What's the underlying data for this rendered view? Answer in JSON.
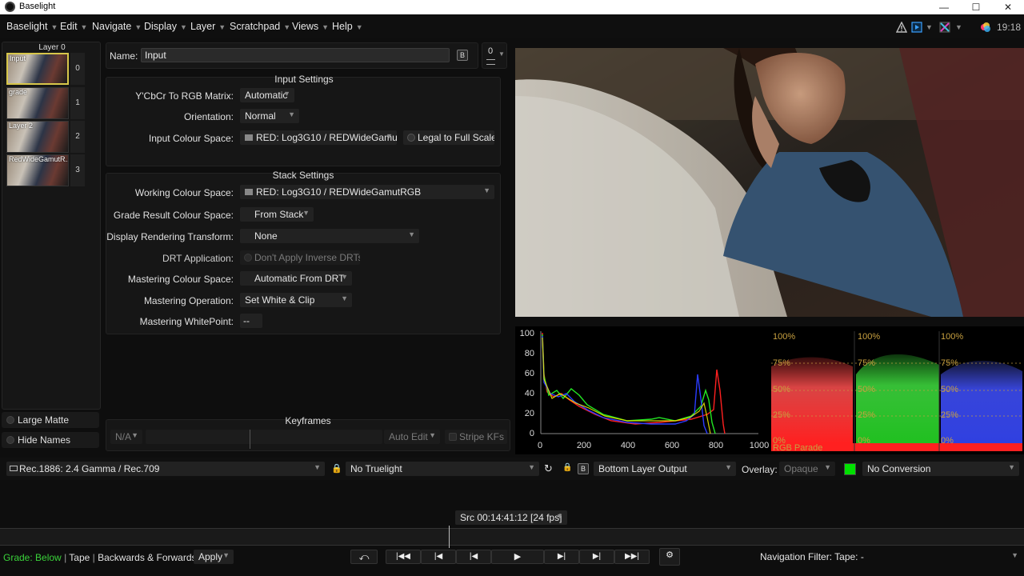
{
  "window": {
    "title": "Baselight",
    "minimize": "—",
    "maximize": "☐",
    "close": "✕"
  },
  "menubar": {
    "items": [
      "Baselight",
      "Edit",
      "Navigate",
      "Display",
      "Layer",
      "Scratchpad",
      "Views",
      "Help"
    ],
    "clock": "19:18"
  },
  "layers": {
    "header": "Layer 0",
    "list": [
      {
        "name": "Input",
        "num": "0"
      },
      {
        "name": "grade",
        "num": "1"
      },
      {
        "name": "Layer 2",
        "num": "2"
      },
      {
        "name": "RedWideGamutR...",
        "num": "3"
      }
    ],
    "large_matte": "Large Matte",
    "hide_names": "Hide Names"
  },
  "name_bar": {
    "label": "Name:",
    "value": "Input",
    "badge": "B",
    "counter": "0"
  },
  "input_settings": {
    "title": "Input Settings",
    "ycbcr_label": "Y'CbCr To RGB Matrix:",
    "ycbcr_value": "Automatic",
    "orientation_label": "Orientation:",
    "orientation_value": "Normal",
    "colour_space_label": "Input Colour Space:",
    "colour_space_value": "RED: Log3G10 / REDWideGamu",
    "legal_button": "Legal to Full Scale"
  },
  "stack_settings": {
    "title": "Stack Settings",
    "working_label": "Working Colour Space:",
    "working_value": "RED: Log3G10 / REDWideGamutRGB",
    "grade_result_label": "Grade Result Colour Space:",
    "grade_result_value": "From Stack",
    "drt_label": "Display Rendering Transform:",
    "drt_value": "None",
    "drt_app_label": "DRT Application:",
    "drt_app_value": "Don't Apply Inverse DRTs",
    "mastering_cs_label": "Mastering Colour Space:",
    "mastering_cs_value": "Automatic From DRT",
    "mastering_op_label": "Mastering Operation:",
    "mastering_op_value": "Set White & Clip",
    "whitepoint_label": "Mastering WhitePoint:",
    "whitepoint_value": "--"
  },
  "keyframes": {
    "title": "Keyframes",
    "na": "N/A",
    "auto_edit": "Auto Edit",
    "stripe": "Stripe KFs"
  },
  "histogram": {
    "y_ticks": [
      "100",
      "80",
      "60",
      "40",
      "20",
      "0"
    ],
    "x_ticks": [
      "0",
      "200",
      "400",
      "600",
      "800",
      "1000"
    ],
    "colors": {
      "red": "#ff2020",
      "green": "#22e622",
      "blue": "#2a3cff",
      "yellow": "#e8e800"
    }
  },
  "parade": {
    "pct_top": "100%",
    "pct_75": "75%",
    "pct_50": "50%",
    "pct_25": "25%",
    "pct_0": "0%",
    "label": "RGB Parade"
  },
  "display_bar": {
    "display": "Rec.1886: 2.4 Gamma / Rec.709",
    "truelight": "No Truelight",
    "output": "Bottom Layer Output",
    "overlay_label": "Overlay:",
    "overlay_value": "Opaque",
    "conversion": "No Conversion",
    "green_swatch": "#00e000"
  },
  "timecode": "Src 00:14:41:12 [24 fps]",
  "transport": {
    "grade_label": "Grade:",
    "grade_value": "Below",
    "tape": "Tape",
    "direction": "Backwards & Forwards",
    "apply": "Apply",
    "nav_filter": "Navigation Filter: Tape: -",
    "buttons": [
      "⤺",
      "|◀◀",
      "|◀",
      "|◀",
      "▶",
      "▶|",
      "▶|",
      "▶▶|"
    ]
  }
}
